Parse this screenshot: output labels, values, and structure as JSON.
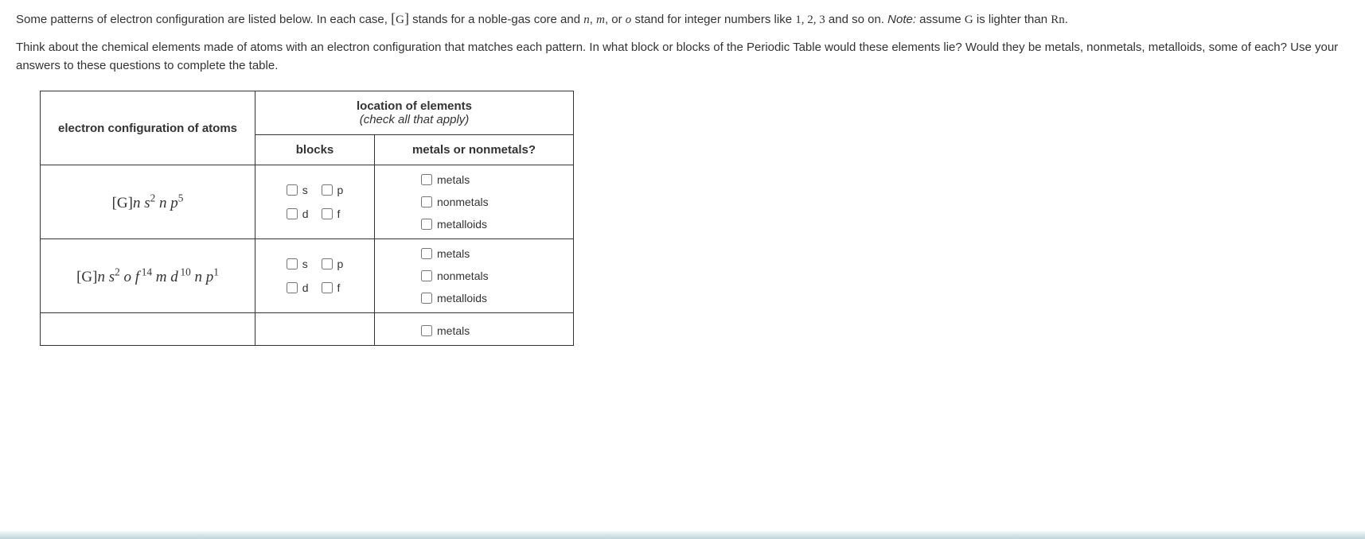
{
  "intro": {
    "p1a": "Some patterns of electron configuration are listed below. In each case, ",
    "p1b": " stands for a noble-gas core and ",
    "p1c": ", or ",
    "p1d": " stand for integer numbers like ",
    "p1e": " and so on. ",
    "note_label": "Note:",
    "p1f": " assume ",
    "p1g": " is lighter than ",
    "p1h": ".",
    "G_bracket_open": "[",
    "G": "G",
    "G_bracket_close": "]",
    "n": "n",
    "m": "m",
    "o": "o",
    "comma": ", ",
    "nums": "1, 2, 3",
    "Rn": "Rn",
    "p2": "Think about the chemical elements made of atoms with an electron configuration that matches each pattern. In what block or blocks of the Periodic Table would these elements lie? Would they be metals, nonmetals, metalloids, some of each? Use your answers to these questions to complete the table."
  },
  "headers": {
    "electron_config": "electron configuration of atoms",
    "location": "location of elements",
    "location_sub": "(check all that apply)",
    "blocks": "blocks",
    "metals_or": "metals or nonmetals?"
  },
  "labels": {
    "s": "s",
    "p": "p",
    "d": "d",
    "f": "f",
    "metals": "metals",
    "nonmetals": "nonmetals",
    "metalloids": "metalloids"
  },
  "chart_data": {
    "type": "table",
    "columns": [
      "electron configuration of atoms",
      "blocks",
      "metals or nonmetals?"
    ],
    "rows": [
      {
        "config": "[G] n s^2 n p^5",
        "blocks": {
          "s": false,
          "p": false,
          "d": false,
          "f": false
        },
        "categories": {
          "metals": false,
          "nonmetals": false,
          "metalloids": false
        }
      },
      {
        "config": "[G] n s^2 o f^14 m d^10 n p^1",
        "blocks": {
          "s": false,
          "p": false,
          "d": false,
          "f": false
        },
        "categories": {
          "metals": false,
          "nonmetals": false,
          "metalloids": false
        }
      },
      {
        "config": "",
        "blocks": {},
        "categories": {
          "metals": false
        }
      }
    ]
  }
}
